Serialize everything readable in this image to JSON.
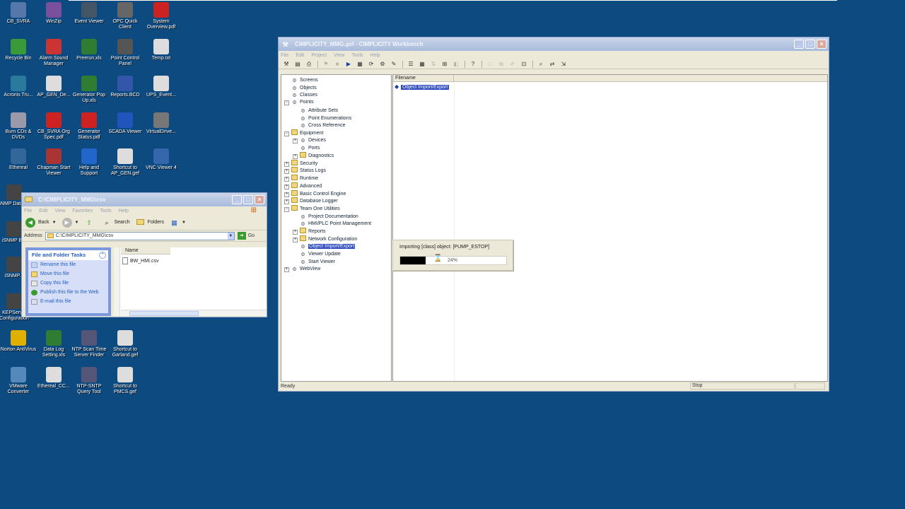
{
  "desktop": {
    "icons": [
      {
        "label": "CB_SVRA",
        "icon": "network-drive-icon",
        "color": "#5577aa"
      },
      {
        "label": "WinZip",
        "icon": "winzip-icon",
        "color": "#7a4f9e"
      },
      {
        "label": "Event Viewer",
        "icon": "event-viewer-icon",
        "color": "#445566"
      },
      {
        "label": "OPC Quick Client",
        "icon": "opc-client-icon",
        "color": "#666666"
      },
      {
        "label": "System Overview.pdf",
        "icon": "pdf-icon",
        "color": "#cc2222"
      },
      {
        "label": "Recycle Bin",
        "icon": "recycle-bin-icon",
        "color": "#3a9a3a"
      },
      {
        "label": "Alarm Sound Manager",
        "icon": "alarm-icon",
        "color": "#cc3333"
      },
      {
        "label": "Preerun.xls",
        "icon": "excel-icon",
        "color": "#2e7d32"
      },
      {
        "label": "Point Control Panel",
        "icon": "control-panel-icon",
        "color": "#555555"
      },
      {
        "label": "Temp.txt",
        "icon": "text-file-icon",
        "color": "#dddddd"
      },
      {
        "label": "Acronis Tru...",
        "icon": "acronis-icon",
        "color": "#2a7a9e"
      },
      {
        "label": "AP_GEN_De...",
        "icon": "document-icon",
        "color": "#dddddd"
      },
      {
        "label": "Generator Pop Up.xls",
        "icon": "excel-icon",
        "color": "#2e7d32"
      },
      {
        "label": "Reports.BCD",
        "icon": "reports-icon",
        "color": "#3355aa"
      },
      {
        "label": "UPS_Event...",
        "icon": "document-icon",
        "color": "#dddddd"
      },
      {
        "label": "Burn CDs & DVDs",
        "icon": "cd-icon",
        "color": "#9a9aaa"
      },
      {
        "label": "CB_SVRA Org Spec.pdf",
        "icon": "pdf-icon",
        "color": "#cc2222"
      },
      {
        "label": "Generator Status.pdf",
        "icon": "pdf-icon",
        "color": "#cc2222"
      },
      {
        "label": "SCADA Viewer",
        "icon": "scada-icon",
        "color": "#2255bb"
      },
      {
        "label": "VirtualDrive...",
        "icon": "virtual-drive-icon",
        "color": "#777777"
      },
      {
        "label": "Ethereal",
        "icon": "ethereal-icon",
        "color": "#336699"
      },
      {
        "label": "Chapman Start Viewer",
        "icon": "viewer-icon",
        "color": "#aa3333"
      },
      {
        "label": "Help and Support",
        "icon": "help-icon",
        "color": "#2266cc"
      },
      {
        "label": "Shortcut to AP_GEN.gef",
        "icon": "gef-shortcut-icon",
        "color": "#dddddd"
      },
      {
        "label": "VNC Viewer 4",
        "icon": "vnc-icon",
        "color": "#3366aa"
      },
      {
        "label": "iSNMP DataW...",
        "icon": "snmp-icon",
        "color": "#444444"
      },
      {
        "label": "iSNMP B...",
        "icon": "snmp-icon",
        "color": "#444444"
      },
      {
        "label": "iSNMP...",
        "icon": "snmp-icon",
        "color": "#444444"
      },
      {
        "label": "KEPServ... Configuration",
        "icon": "kepserver-icon",
        "color": "#444444"
      },
      {
        "label": "Norton AntiVirus",
        "icon": "norton-icon",
        "color": "#e0b000"
      },
      {
        "label": "Data Log Setting.xls",
        "icon": "excel-icon",
        "color": "#2e7d32"
      },
      {
        "label": "NTP Scan Time Server Finder",
        "icon": "ntp-icon",
        "color": "#555577"
      },
      {
        "label": "Shortcut to Garland.gef",
        "icon": "gef-shortcut-icon",
        "color": "#dddddd"
      },
      {
        "label": "VMware Converter",
        "icon": "vmware-icon",
        "color": "#5588bb"
      },
      {
        "label": "Ethereal_CC...",
        "icon": "document-icon",
        "color": "#dddddd"
      },
      {
        "label": "NTP-SNTP Query Tool",
        "icon": "ntp-icon",
        "color": "#555577"
      },
      {
        "label": "Shortcut to PMCS.gef",
        "icon": "gef-shortcut-icon",
        "color": "#dddddd"
      }
    ]
  },
  "workbench": {
    "title": "CIMPLICITY_MMG.gef - CIMPLICITY Workbench",
    "menu": [
      "File",
      "Edit",
      "Project",
      "View",
      "Tools",
      "Help"
    ],
    "tree": [
      {
        "label": "Screens",
        "depth": 1,
        "icon": "screens-icon",
        "expander": "",
        "selected": false
      },
      {
        "label": "Objects",
        "depth": 1,
        "icon": "objects-icon",
        "expander": "",
        "selected": false
      },
      {
        "label": "Classes",
        "depth": 1,
        "icon": "classes-icon",
        "expander": "",
        "selected": false
      },
      {
        "label": "Points",
        "depth": 1,
        "icon": "points-icon",
        "expander": "−",
        "selected": false
      },
      {
        "label": "Attribute Sets",
        "depth": 2,
        "icon": "attribute-sets-icon",
        "expander": "",
        "selected": false
      },
      {
        "label": "Point Enumerations",
        "depth": 2,
        "icon": "enumerations-icon",
        "expander": "",
        "selected": false
      },
      {
        "label": "Cross Reference",
        "depth": 2,
        "icon": "cross-reference-icon",
        "expander": "",
        "selected": false
      },
      {
        "label": "Equipment",
        "depth": 1,
        "icon": "folder-icon",
        "expander": "−",
        "selected": false
      },
      {
        "label": "Devices",
        "depth": 2,
        "icon": "devices-icon",
        "expander": "+",
        "selected": false
      },
      {
        "label": "Ports",
        "depth": 2,
        "icon": "ports-icon",
        "expander": "",
        "selected": false
      },
      {
        "label": "Diagnostics",
        "depth": 2,
        "icon": "folder-icon",
        "expander": "+",
        "selected": false
      },
      {
        "label": "Security",
        "depth": 1,
        "icon": "folder-icon",
        "expander": "+",
        "selected": false
      },
      {
        "label": "Status Logs",
        "depth": 1,
        "icon": "folder-icon",
        "expander": "+",
        "selected": false
      },
      {
        "label": "Runtime",
        "depth": 1,
        "icon": "folder-icon",
        "expander": "+",
        "selected": false
      },
      {
        "label": "Advanced",
        "depth": 1,
        "icon": "folder-icon",
        "expander": "+",
        "selected": false
      },
      {
        "label": "Basic Control Engine",
        "depth": 1,
        "icon": "folder-icon",
        "expander": "+",
        "selected": false
      },
      {
        "label": "Database Logger",
        "depth": 1,
        "icon": "folder-icon",
        "expander": "+",
        "selected": false
      },
      {
        "label": "Team One Utilities",
        "depth": 1,
        "icon": "folder-icon",
        "expander": "−",
        "selected": false
      },
      {
        "label": "Project Documentation",
        "depth": 2,
        "icon": "documentation-icon",
        "expander": "",
        "selected": false
      },
      {
        "label": "HMI/PLC Point Management",
        "depth": 2,
        "icon": "point-management-icon",
        "expander": "",
        "selected": false
      },
      {
        "label": "Reports",
        "depth": 2,
        "icon": "folder-icon",
        "expander": "+",
        "selected": false
      },
      {
        "label": "Network Configuration",
        "depth": 2,
        "icon": "folder-icon",
        "expander": "+",
        "selected": false
      },
      {
        "label": "Object Import/Export",
        "depth": 2,
        "icon": "import-export-icon",
        "expander": "",
        "selected": true
      },
      {
        "label": "Viewer Update",
        "depth": 2,
        "icon": "viewer-update-icon",
        "expander": "",
        "selected": false
      },
      {
        "label": "Start Viewer",
        "depth": 2,
        "icon": "start-viewer-icon",
        "expander": "",
        "selected": false
      },
      {
        "label": "WebView",
        "depth": 1,
        "icon": "webview-icon",
        "expander": "+",
        "selected": false
      }
    ],
    "list": {
      "column_header": "Filename",
      "rows": [
        "Object Import/Export"
      ]
    },
    "progress": {
      "message": "Importing [class] object: [PUMP_ESTOP]",
      "percent_label": "24%",
      "percent": 24
    },
    "status": {
      "left": "Ready",
      "right": "Stop"
    }
  },
  "explorer": {
    "title": "C:\\CIMPLICITY_MMG\\csv",
    "menu": [
      "File",
      "Edit",
      "View",
      "Favorites",
      "Tools",
      "Help"
    ],
    "toolbar": {
      "back": "Back",
      "search": "Search",
      "folders": "Folders"
    },
    "address_label": "Address",
    "address_value": "C:\\CIMPLICITY_MMG\\csv",
    "go_label": "Go",
    "tasks": {
      "header": "File and Folder Tasks",
      "items": [
        "Rename this file",
        "Move this file",
        "Copy this file",
        "Publish this file to the Web",
        "E-mail this file"
      ]
    },
    "files": {
      "column_header": "Name",
      "items": [
        "BW_HMI.csv"
      ]
    }
  }
}
